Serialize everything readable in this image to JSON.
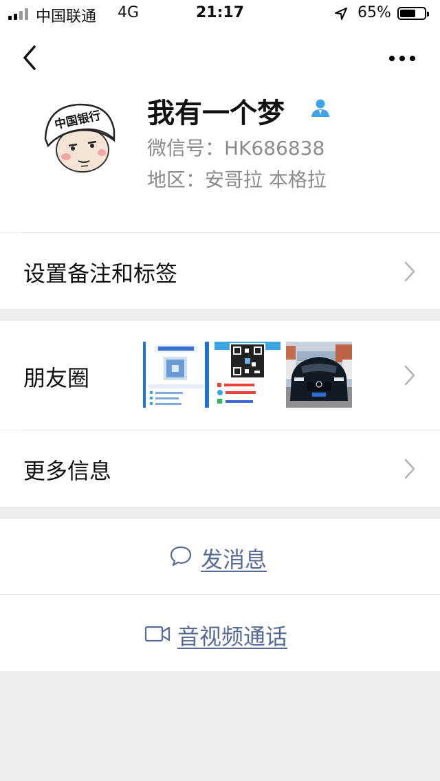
{
  "status_bar": {
    "carrier": "中国联通",
    "network": "4G",
    "time": "21:17",
    "battery": "65%",
    "battery_level": 0.65
  },
  "nav": {
    "back_icon": "chevron-left-icon",
    "more_icon": "ellipsis-icon"
  },
  "profile": {
    "name": "我有一个梦",
    "wechat_id": "微信号：HK686838",
    "region": "地区：安哥拉 本格拉",
    "avatar_text": "中国银行"
  },
  "rows": {
    "remark_tags": "设置备注和标签",
    "moments": "朋友圈",
    "more_info": "更多信息"
  },
  "actions": {
    "send_message": "发消息",
    "video_call": "音视频通话"
  },
  "colors": {
    "link": "#576b95",
    "background": "#ededed",
    "divider": "#e0e0e0",
    "user_icon": "#2b9de6"
  }
}
